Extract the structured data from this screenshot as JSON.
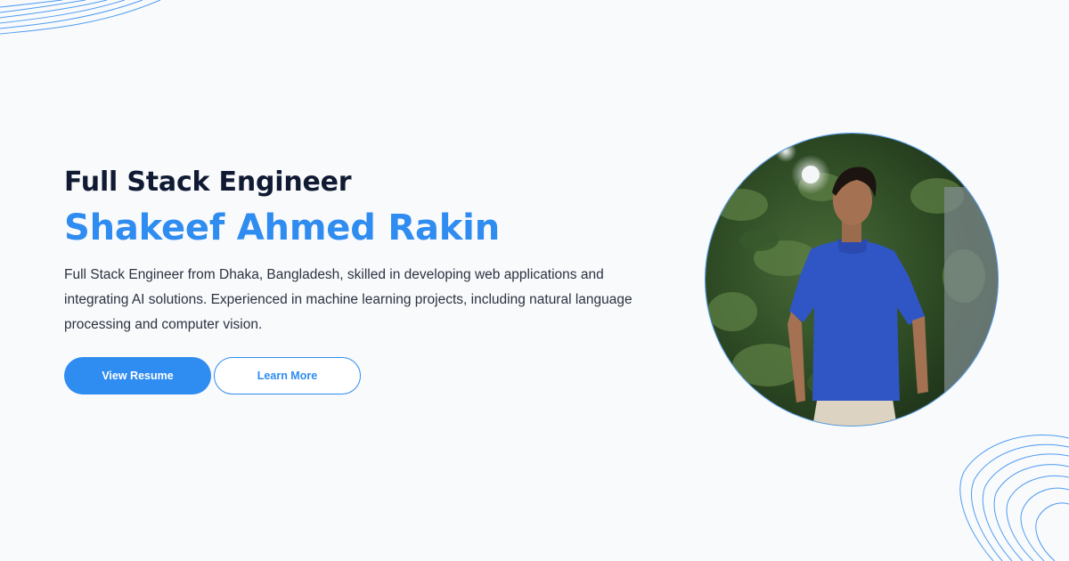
{
  "hero": {
    "role": "Full Stack Engineer",
    "name": "Shakeef Ahmed Rakin",
    "description": "Full Stack Engineer from Dhaka, Bangladesh, skilled in developing web applications and integrating AI solutions. Experienced in machine learning projects, including natural language processing and computer vision."
  },
  "actions": {
    "primary_label": "View Resume",
    "secondary_label": "Learn More"
  },
  "colors": {
    "accent": "#2f8cf0",
    "heading": "#101a33",
    "background": "#f9fafc"
  }
}
